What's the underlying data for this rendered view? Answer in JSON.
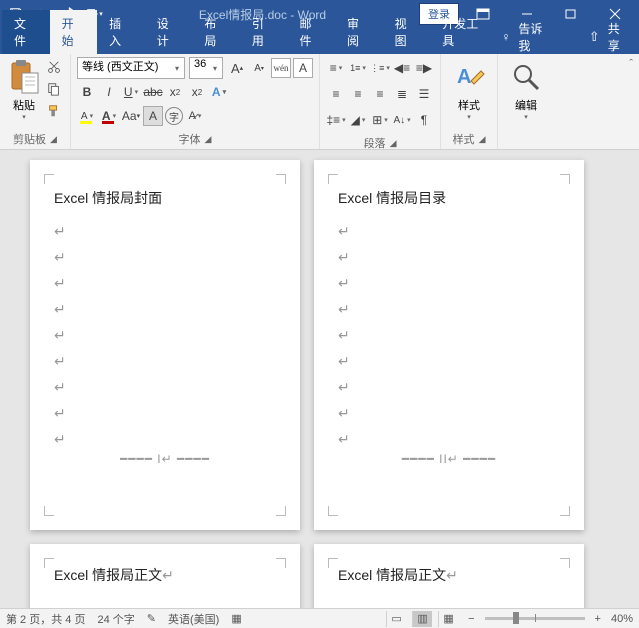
{
  "titlebar": {
    "doc_name": "Excel情报局.doc  -  Word",
    "login": "登录"
  },
  "tabs": {
    "file": "文件",
    "home": "开始",
    "insert": "插入",
    "design": "设计",
    "layout": "布局",
    "references": "引用",
    "mailings": "邮件",
    "review": "审阅",
    "view": "视图",
    "dev": "开发工具",
    "tellme": "告诉我",
    "share": "共享"
  },
  "ribbon": {
    "clipboard": {
      "paste": "粘贴",
      "label": "剪贴板"
    },
    "font": {
      "name": "等线 (西文正文)",
      "size": "36",
      "wen": "wén",
      "label": "字体"
    },
    "paragraph": {
      "label": "段落"
    },
    "styles": {
      "btn": "样式",
      "label": "样式"
    },
    "editing": {
      "btn": "编辑"
    }
  },
  "pages": {
    "p1_title": "Excel 情报局封面",
    "p2_title": "Excel 情报局目录",
    "p3_title": "Excel 情报局正文",
    "p4_title": "Excel 情报局正文",
    "break1": "I",
    "break2": "II"
  },
  "status": {
    "page": "第 2 页，共 4 页",
    "words": "24 个字",
    "lang": "英语(美国)",
    "zoom": "40%"
  }
}
